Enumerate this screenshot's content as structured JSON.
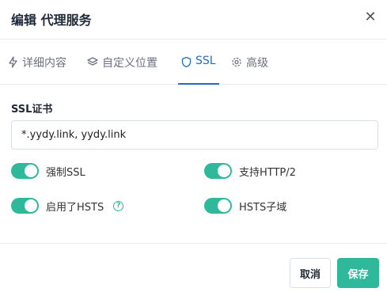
{
  "dialog": {
    "title": "编辑 代理服务"
  },
  "tabs": [
    {
      "label": "详细内容",
      "icon": "bolt-icon"
    },
    {
      "label": "自定义位置",
      "icon": "layers-icon"
    },
    {
      "label": "SSL",
      "icon": "shield-icon",
      "active": true
    },
    {
      "label": "高级",
      "icon": "gear-icon"
    }
  ],
  "ssl": {
    "cert_label": "SSL证书",
    "cert_value": "*.yydy.link, yydy.link"
  },
  "toggles": {
    "force_ssl": {
      "label": "强制SSL",
      "on": true
    },
    "http2": {
      "label": "支持HTTP/2",
      "on": true
    },
    "hsts": {
      "label": "启用了HSTS",
      "on": true,
      "help": "?"
    },
    "hsts_subdomains": {
      "label": "HSTS子域",
      "on": true
    }
  },
  "footer": {
    "cancel_label": "取消",
    "save_label": "保存"
  },
  "colors": {
    "accent": "#2fb99a",
    "tab_active": "#206bc4"
  }
}
